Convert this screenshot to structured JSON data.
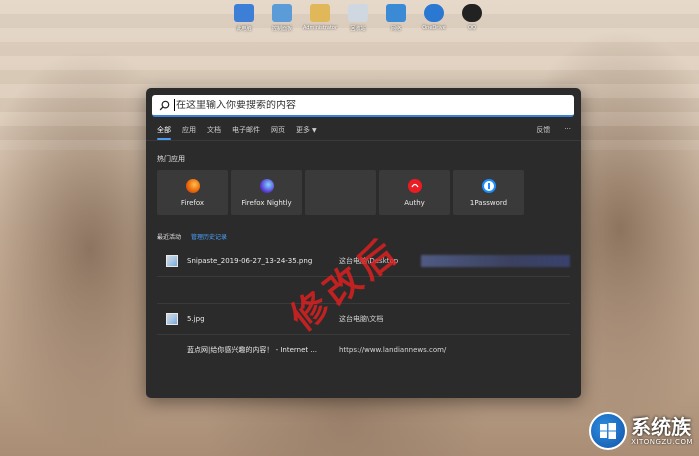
{
  "desktop_icons": [
    {
      "label": "此电脑",
      "icon": "computer-icon",
      "color": "#3d7fd6"
    },
    {
      "label": "控制面板",
      "icon": "control-panel-icon",
      "color": "#5b9bd8"
    },
    {
      "label": "Administrator",
      "icon": "user-folder-icon",
      "color": "#e0b85a"
    },
    {
      "label": "回收站",
      "icon": "recycle-bin-icon",
      "color": "#cfd8e0"
    },
    {
      "label": "网络",
      "icon": "network-icon",
      "color": "#3a8ad6"
    },
    {
      "label": "OneDrive",
      "icon": "onedrive-icon",
      "color": "#2a78d2"
    },
    {
      "label": "QQ",
      "icon": "qq-icon",
      "color": "#222222"
    }
  ],
  "search": {
    "placeholder": "在这里输入你要搜索的内容",
    "value": ""
  },
  "tabs": [
    {
      "label": "全部",
      "active": true
    },
    {
      "label": "应用",
      "active": false
    },
    {
      "label": "文档",
      "active": false
    },
    {
      "label": "电子邮件",
      "active": false
    },
    {
      "label": "网页",
      "active": false
    },
    {
      "label": "更多",
      "active": false,
      "dropdown": true
    }
  ],
  "tabs_right": {
    "feedback": "反馈",
    "more": "···"
  },
  "top_apps": {
    "title": "热门应用",
    "items": [
      {
        "name": "Firefox",
        "icon": "firefox-icon",
        "color": "#e66000"
      },
      {
        "name": "Firefox Nightly",
        "icon": "firefox-nightly-icon",
        "color": "#5b3fd6"
      },
      {
        "name": "",
        "icon": "",
        "color": ""
      },
      {
        "name": "Authy",
        "icon": "authy-icon",
        "color": "#ec1c24"
      },
      {
        "name": "1Password",
        "icon": "onepassword-icon",
        "color": "#1a8cff"
      }
    ]
  },
  "recent": {
    "title": "最近活动",
    "manage_link": "管理历史记录",
    "items": [
      {
        "name": "Snipaste_2019-06-27_13-24-35.png",
        "path": "这台电脑\\Desktop",
        "has_icon": true
      },
      {
        "name": "",
        "path": "",
        "has_icon": false
      },
      {
        "name": "5.jpg",
        "path": "这台电脑\\文档",
        "has_icon": true
      },
      {
        "name": "蓝点网|给你感兴趣的内容！ - Internet ...",
        "path": "https://www.landiannews.com/",
        "has_icon": false
      }
    ]
  },
  "watermark": "修改后",
  "logo": {
    "text": "系统族",
    "url": "XITONGZU.COM"
  },
  "colors": {
    "accent": "#4a9cf0",
    "panel": "#2b2b2b",
    "tile": "#3a3a3a",
    "watermark": "#e22020"
  }
}
